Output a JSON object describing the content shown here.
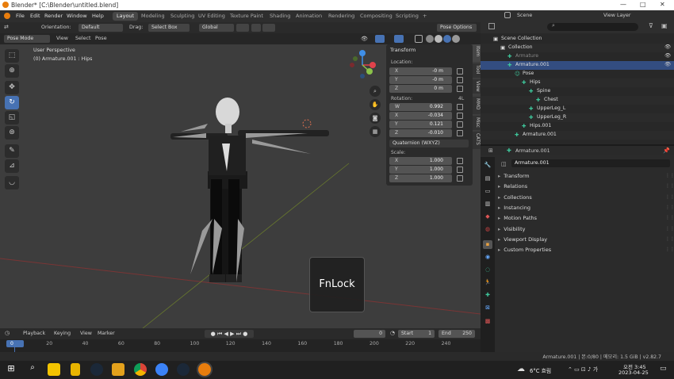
{
  "window": {
    "title": "Blender* [C:\\Blender\\untitled.blend]",
    "controls": [
      "—",
      "□",
      "✕"
    ]
  },
  "menu": [
    "File",
    "Edit",
    "Render",
    "Window",
    "Help"
  ],
  "workspaces": [
    "Layout",
    "Modeling",
    "Sculpting",
    "UV Editing",
    "Texture Paint",
    "Shading",
    "Animation",
    "Rendering",
    "Compositing",
    "Scripting",
    "+"
  ],
  "scene": {
    "label": "Scene",
    "view_layer": "View Layer"
  },
  "vp_header": {
    "orientation_label": "Orientation:",
    "orientation": "Default",
    "drag_label": "Drag:",
    "drag": "Select Box",
    "transform": "Global",
    "pose_options": "Pose Options"
  },
  "vp_header2": {
    "mode": "Pose Mode",
    "items": [
      "View",
      "Select",
      "Pose"
    ]
  },
  "viewport": {
    "perspective": "User Perspective",
    "object": "(0) Armature.001 : Hips"
  },
  "npanel": {
    "header": "Transform",
    "location_label": "Location:",
    "location": [
      {
        "axis": "X",
        "value": "-0 m"
      },
      {
        "axis": "Y",
        "value": "-0 m"
      },
      {
        "axis": "Z",
        "value": "0 m"
      }
    ],
    "rotation_label": "Rotation:",
    "rotation_mode_badge": "4L",
    "rotation": [
      {
        "axis": "W",
        "value": "0.992"
      },
      {
        "axis": "X",
        "value": "-0.034"
      },
      {
        "axis": "Y",
        "value": "0.121"
      },
      {
        "axis": "Z",
        "value": "-0.010"
      }
    ],
    "rotation_mode": "Quaternion (WXYZ)",
    "scale_label": "Scale:",
    "scale": [
      {
        "axis": "X",
        "value": "1.000"
      },
      {
        "axis": "Y",
        "value": "1.000"
      },
      {
        "axis": "Z",
        "value": "1.000"
      }
    ],
    "tabs": [
      "Item",
      "Tool",
      "View",
      "MMD",
      "Misc",
      "CATS"
    ]
  },
  "fnlock": "FnLock",
  "timeline": {
    "menus": [
      "Playback",
      "Keying",
      "View",
      "Marker"
    ],
    "current": "0",
    "start_label": "Start",
    "start": "1",
    "end_label": "End",
    "end": "250",
    "ruler": [
      "0",
      "20",
      "40",
      "60",
      "80",
      "100",
      "120",
      "140",
      "160",
      "180",
      "200",
      "220",
      "240"
    ]
  },
  "outliner": {
    "rows": [
      {
        "name": "Scene Collection",
        "indent": 0
      },
      {
        "name": "Collection",
        "indent": 1
      },
      {
        "name": "Armature",
        "indent": 2
      },
      {
        "name": "Armature.001",
        "indent": 2
      },
      {
        "name": "Pose",
        "indent": 3
      },
      {
        "name": "Hips",
        "indent": 4
      },
      {
        "name": "Spine",
        "indent": 5
      },
      {
        "name": "Chest",
        "indent": 6
      },
      {
        "name": "UpperLeg_L",
        "indent": 5
      },
      {
        "name": "UpperLeg_R",
        "indent": 5
      },
      {
        "name": "Hips.001",
        "indent": 4
      },
      {
        "name": "Armature.001",
        "indent": 3
      }
    ]
  },
  "properties": {
    "object": "Armature.001",
    "name_field": "Armature.001",
    "sections": [
      "Transform",
      "Relations",
      "Collections",
      "Instancing",
      "Motion Paths",
      "Visibility",
      "Viewport Display",
      "Custom Properties"
    ]
  },
  "status": "Armature.001 | 본:0/80 | 메모리: 1.5 GiB | v2.82.7",
  "taskbar": {
    "weather": "6°C 흐림",
    "time": "오전 3:45",
    "date": "2023-04-25"
  },
  "colors": {
    "accent": "#4772b3",
    "bone": "#3ec79c",
    "axis_x": "#e0424b",
    "axis_y": "#8bc34a",
    "axis_z": "#3f8fe8"
  }
}
